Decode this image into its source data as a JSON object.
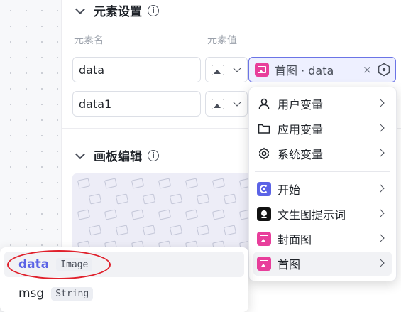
{
  "element_settings": {
    "title": "元素设置",
    "col_name": "元素名",
    "col_value": "元素值"
  },
  "rows": [
    {
      "name": "data",
      "value_label": "首图 · data"
    },
    {
      "name": "data1"
    }
  ],
  "canvas_edit": {
    "title": "画板编辑"
  },
  "menu": {
    "items": [
      {
        "label": "用户变量",
        "icon": "user-icon"
      },
      {
        "label": "应用变量",
        "icon": "folder-icon"
      },
      {
        "label": "系统变量",
        "icon": "gear-icon"
      },
      {
        "label": "开始",
        "icon": "start-icon"
      },
      {
        "label": "文生图提示词",
        "icon": "text-to-image-icon"
      },
      {
        "label": "封面图",
        "icon": "image-node-icon"
      },
      {
        "label": "首图",
        "icon": "image-node-icon"
      }
    ]
  },
  "variables": [
    {
      "name": "data",
      "type": "Image"
    },
    {
      "name": "msg",
      "type": "String"
    }
  ],
  "colors": {
    "accent": "#5b63e6",
    "pink": "#e83e9b",
    "annotation": "#e0202b"
  }
}
